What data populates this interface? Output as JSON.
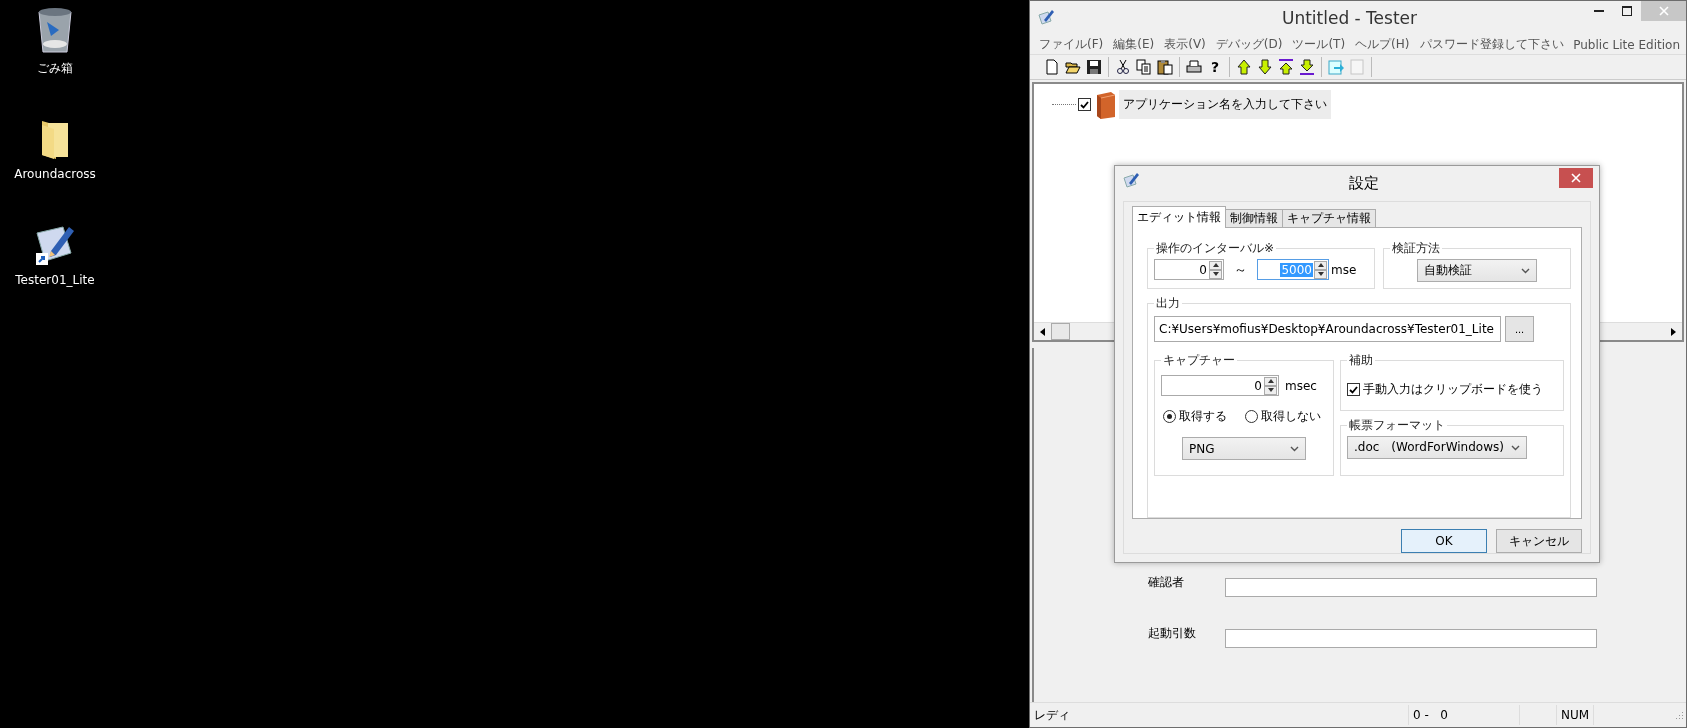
{
  "desktop": {
    "icons": [
      {
        "kind": "trash",
        "label": "ごみ箱"
      },
      {
        "kind": "folder",
        "label": "Aroundacross"
      },
      {
        "kind": "app",
        "label": "Tester01_Lite"
      }
    ]
  },
  "window": {
    "title": "Untitled - Tester",
    "menu": [
      "ファイル(F)",
      "編集(E)",
      "表示(V)",
      "デバッグ(D)",
      "ツール(T)",
      "ヘルプ(H)",
      "パスワード登録して下さい"
    ],
    "edition": "Public Lite Edition",
    "toolbar": [
      [
        {
          "kind": "new",
          "disabled": false
        },
        {
          "kind": "open",
          "disabled": false
        },
        {
          "kind": "save",
          "disabled": false
        }
      ],
      [
        {
          "kind": "cut",
          "disabled": false
        },
        {
          "kind": "copy",
          "disabled": false
        },
        {
          "kind": "paste",
          "disabled": false
        }
      ],
      [
        {
          "kind": "print",
          "disabled": false
        },
        {
          "kind": "help",
          "glyph": "?",
          "disabled": false
        }
      ],
      [
        {
          "kind": "up",
          "disabled": false
        },
        {
          "kind": "down",
          "disabled": false
        },
        {
          "kind": "top",
          "disabled": false
        },
        {
          "kind": "bottom",
          "disabled": false
        }
      ],
      [
        {
          "kind": "export",
          "disabled": false
        },
        {
          "kind": "blank",
          "disabled": true
        }
      ]
    ],
    "tree": [
      {
        "label": "アプリケーション名を入力して下さい",
        "checked": true,
        "selected": true
      }
    ],
    "form": [
      {
        "label": "確認者"
      },
      {
        "label": "起動引数"
      }
    ],
    "status_bar": [
      "レディ",
      "0 -   0",
      "NUM"
    ]
  },
  "dialog": {
    "title": "設定",
    "tabs": [
      {
        "label": "エディット情報",
        "selected": true
      },
      {
        "label": "制御情報",
        "selected": false
      },
      {
        "label": "キャプチャ情報",
        "selected": false
      }
    ],
    "interval": {
      "label": "操作のインターバル※",
      "from": "0",
      "separator": "～",
      "to": "5000",
      "unit": "mse"
    },
    "verify": {
      "label": "検証方法",
      "value": "自動検証"
    },
    "output": {
      "label": "出力",
      "path": "C:¥Users¥mofius¥Desktop¥Aroundacross¥Tester01_Lite",
      "browse": "..."
    },
    "capture": {
      "label": "キャプチャー",
      "value": "0",
      "unit": "msec",
      "options": [
        {
          "label": "取得する",
          "selected": true
        },
        {
          "label": "取得しない",
          "selected": false
        }
      ],
      "format": "PNG"
    },
    "assist": {
      "label": "補助",
      "checkbox": {
        "label": "手動入力はクリップボードを使う",
        "checked": true
      }
    },
    "report": {
      "label": "帳票フォーマット",
      "value": ".doc　(WordForWindows)"
    },
    "buttons": [
      {
        "label": "OK",
        "default": true
      },
      {
        "label": "キャンセル",
        "default": false
      }
    ]
  }
}
